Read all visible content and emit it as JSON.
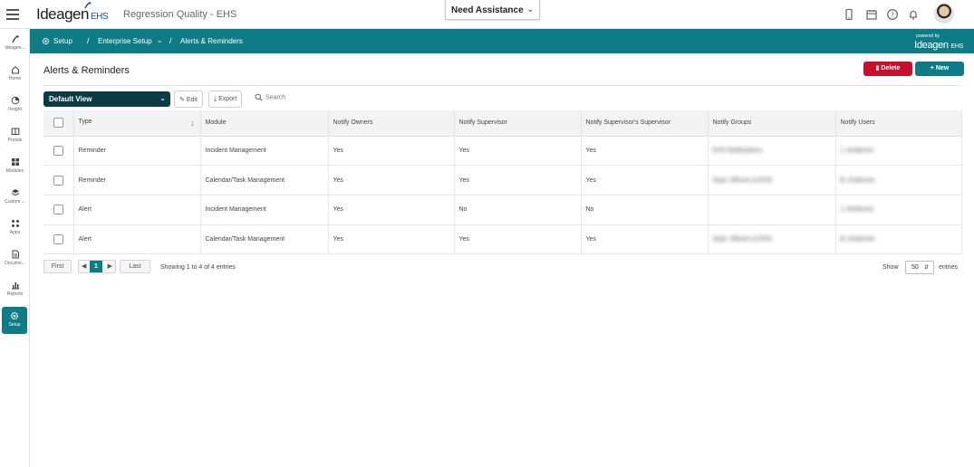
{
  "header": {
    "brand": "Ideagen",
    "brand_suffix": "EHS",
    "app_title": "Regression Quality - EHS",
    "assist_label": "Need Assistance"
  },
  "sidebar": {
    "items": [
      {
        "label": "Ideagen...",
        "icon": "ideagen-icon"
      },
      {
        "label": "Home",
        "icon": "home-icon"
      },
      {
        "label": "Insight",
        "icon": "insight-icon"
      },
      {
        "label": "Portals",
        "icon": "portals-icon"
      },
      {
        "label": "Modules",
        "icon": "modules-icon"
      },
      {
        "label": "Custom ...",
        "icon": "custom-icon"
      },
      {
        "label": "Apps",
        "icon": "apps-icon"
      },
      {
        "label": "Docume...",
        "icon": "document-icon"
      },
      {
        "label": "Reports",
        "icon": "reports-icon"
      },
      {
        "label": "Setup",
        "icon": "gear-icon"
      }
    ]
  },
  "breadcrumb": {
    "items": [
      "Setup",
      "Enterprise Setup",
      "Alerts & Reminders"
    ],
    "sep": "/",
    "powered_by": "powered by",
    "powered_brand": "Ideagen",
    "powered_suffix": "EHS"
  },
  "page": {
    "title": "Alerts & Reminders",
    "delete_label": "Delete",
    "new_label": "New"
  },
  "toolbar": {
    "view": "Default View",
    "edit_label": "Edit",
    "export_label": "Export",
    "search_label": "Search"
  },
  "table": {
    "columns": [
      "Type",
      "Module",
      "Notify Owners",
      "Notify Supervisor",
      "Notify Supervisor's Supervisor",
      "Notify Groups",
      "Notify Users"
    ],
    "rows": [
      {
        "type": "Reminder",
        "module": "Incident Management",
        "owners": "Yes",
        "supervisor": "Yes",
        "sup_sup": "Yes",
        "groups": "EHS Notifications",
        "users": "J. Anderson"
      },
      {
        "type": "Reminder",
        "module": "Calendar/Task Management",
        "owners": "Yes",
        "supervisor": "Yes",
        "sup_sup": "Yes",
        "groups": "Dept. Officers & EHS",
        "users": "B. Anderson"
      },
      {
        "type": "Alert",
        "module": "Incident Management",
        "owners": "Yes",
        "supervisor": "No",
        "sup_sup": "No",
        "groups": "",
        "users": "J. Anderson"
      },
      {
        "type": "Alert",
        "module": "Calendar/Task Management",
        "owners": "Yes",
        "supervisor": "Yes",
        "sup_sup": "Yes",
        "groups": "Dept. Officers & EHS",
        "users": "B. Anderson"
      }
    ]
  },
  "pagination": {
    "first": "First",
    "last": "Last",
    "current": "1",
    "showing": "Showing 1 to 4 of 4 entries",
    "show_label": "Show",
    "page_size": "50",
    "entries_label": "entries"
  }
}
